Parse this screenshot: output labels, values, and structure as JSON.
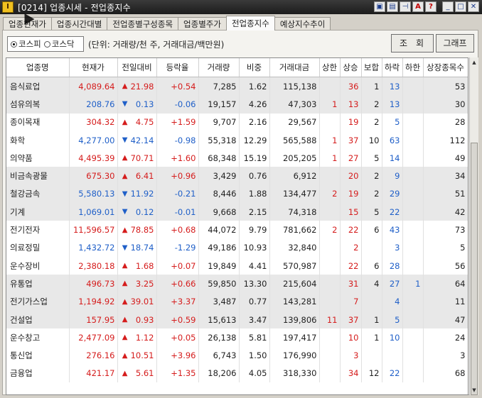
{
  "window": {
    "title": "[0214] 업종시세 - 전업종지수",
    "app_icon": "I"
  },
  "tabs": [
    {
      "label": "업종현재가",
      "active": false
    },
    {
      "label": "업종시간대별",
      "active": false
    },
    {
      "label": "전업종별구성종목",
      "active": false
    },
    {
      "label": "업종별주가",
      "active": false
    },
    {
      "label": "전업종지수",
      "active": true
    },
    {
      "label": "예상지수추이",
      "active": false
    }
  ],
  "filters": {
    "market_kospi": "코스피",
    "market_kosdaq": "코스닥",
    "selected": "코스피",
    "unit_text": "(단위: 거래량/천 주, 거래대금/백만원)"
  },
  "buttons": {
    "search": "조회",
    "graph": "그래프"
  },
  "table": {
    "headers": [
      "업종명",
      "현재가",
      "전일대비",
      "등락율",
      "거래량",
      "비중",
      "거래대금",
      "상한",
      "상승",
      "보합",
      "하락",
      "하한",
      "상장종목수"
    ],
    "rows": [
      {
        "name": "음식료업",
        "price": "4,089.64",
        "dir": "up",
        "change": "21.98",
        "rate": "+0.54",
        "volume": "7,285",
        "weight": "1.62",
        "amount": "115,138",
        "upper": "",
        "rise": "36",
        "flat": "1",
        "fall": "13",
        "lower": "",
        "listed": "53"
      },
      {
        "name": "섬유의복",
        "price": "208.76",
        "dir": "dn",
        "change": "0.13",
        "rate": "-0.06",
        "volume": "19,157",
        "weight": "4.26",
        "amount": "47,303",
        "upper": "1",
        "rise": "13",
        "flat": "2",
        "fall": "13",
        "lower": "",
        "listed": "30"
      },
      {
        "name": "종이목재",
        "price": "304.32",
        "dir": "up",
        "change": "4.75",
        "rate": "+1.59",
        "volume": "9,707",
        "weight": "2.16",
        "amount": "29,567",
        "upper": "",
        "rise": "19",
        "flat": "2",
        "fall": "5",
        "lower": "",
        "listed": "28"
      },
      {
        "name": "화학",
        "price": "4,277.00",
        "dir": "dn",
        "change": "42.14",
        "rate": "-0.98",
        "volume": "55,318",
        "weight": "12.29",
        "amount": "565,588",
        "upper": "1",
        "rise": "37",
        "flat": "10",
        "fall": "63",
        "lower": "",
        "listed": "112"
      },
      {
        "name": "의약품",
        "price": "4,495.39",
        "dir": "up",
        "change": "70.71",
        "rate": "+1.60",
        "volume": "68,348",
        "weight": "15.19",
        "amount": "205,205",
        "upper": "1",
        "rise": "27",
        "flat": "5",
        "fall": "14",
        "lower": "",
        "listed": "49"
      },
      {
        "name": "비금속광물",
        "price": "675.30",
        "dir": "up",
        "change": "6.41",
        "rate": "+0.96",
        "volume": "3,429",
        "weight": "0.76",
        "amount": "6,912",
        "upper": "",
        "rise": "20",
        "flat": "2",
        "fall": "9",
        "lower": "",
        "listed": "34"
      },
      {
        "name": "철강금속",
        "price": "5,580.13",
        "dir": "dn",
        "change": "11.92",
        "rate": "-0.21",
        "volume": "8,446",
        "weight": "1.88",
        "amount": "134,477",
        "upper": "2",
        "rise": "19",
        "flat": "2",
        "fall": "29",
        "lower": "",
        "listed": "51"
      },
      {
        "name": "기계",
        "price": "1,069.01",
        "dir": "dn",
        "change": "0.12",
        "rate": "-0.01",
        "volume": "9,668",
        "weight": "2.15",
        "amount": "74,318",
        "upper": "",
        "rise": "15",
        "flat": "5",
        "fall": "22",
        "lower": "",
        "listed": "42"
      },
      {
        "name": "전기전자",
        "price": "11,596.57",
        "dir": "up",
        "change": "78.85",
        "rate": "+0.68",
        "volume": "44,072",
        "weight": "9.79",
        "amount": "781,662",
        "upper": "2",
        "rise": "22",
        "flat": "6",
        "fall": "43",
        "lower": "",
        "listed": "73"
      },
      {
        "name": "의료정밀",
        "price": "1,432.72",
        "dir": "dn",
        "change": "18.74",
        "rate": "-1.29",
        "volume": "49,186",
        "weight": "10.93",
        "amount": "32,840",
        "upper": "",
        "rise": "2",
        "flat": "",
        "fall": "3",
        "lower": "",
        "listed": "5"
      },
      {
        "name": "운수장비",
        "price": "2,380.18",
        "dir": "up",
        "change": "1.68",
        "rate": "+0.07",
        "volume": "19,849",
        "weight": "4.41",
        "amount": "570,987",
        "upper": "",
        "rise": "22",
        "flat": "6",
        "fall": "28",
        "lower": "",
        "listed": "56"
      },
      {
        "name": "유통업",
        "price": "496.73",
        "dir": "up",
        "change": "3.25",
        "rate": "+0.66",
        "volume": "59,850",
        "weight": "13.30",
        "amount": "215,604",
        "upper": "",
        "rise": "31",
        "flat": "4",
        "fall": "27",
        "lower": "1",
        "listed": "64"
      },
      {
        "name": "전기가스업",
        "price": "1,194.92",
        "dir": "up",
        "change": "39.01",
        "rate": "+3.37",
        "volume": "3,487",
        "weight": "0.77",
        "amount": "143,281",
        "upper": "",
        "rise": "7",
        "flat": "",
        "fall": "4",
        "lower": "",
        "listed": "11"
      },
      {
        "name": "건설업",
        "price": "157.95",
        "dir": "up",
        "change": "0.93",
        "rate": "+0.59",
        "volume": "15,613",
        "weight": "3.47",
        "amount": "139,806",
        "upper": "11",
        "rise": "37",
        "flat": "1",
        "fall": "5",
        "lower": "",
        "listed": "47"
      },
      {
        "name": "운수창고",
        "price": "2,477.09",
        "dir": "up",
        "change": "1.12",
        "rate": "+0.05",
        "volume": "26,138",
        "weight": "5.81",
        "amount": "197,417",
        "upper": "",
        "rise": "10",
        "flat": "1",
        "fall": "10",
        "lower": "",
        "listed": "24"
      },
      {
        "name": "통신업",
        "price": "276.16",
        "dir": "up",
        "change": "10.51",
        "rate": "+3.96",
        "volume": "6,743",
        "weight": "1.50",
        "amount": "176,990",
        "upper": "",
        "rise": "3",
        "flat": "",
        "fall": "",
        "lower": "",
        "listed": "3"
      },
      {
        "name": "금융업",
        "price": "421.17",
        "dir": "up",
        "change": "5.61",
        "rate": "+1.35",
        "volume": "18,206",
        "weight": "4.05",
        "amount": "318,330",
        "upper": "",
        "rise": "34",
        "flat": "12",
        "fall": "22",
        "lower": "",
        "listed": "68"
      }
    ]
  },
  "colors": {
    "up": "#d51c1c",
    "down": "#1f5fc8",
    "shade": "#e8e8e8"
  },
  "icons": {
    "up_arrow": "▲",
    "down_arrow": "▼"
  }
}
